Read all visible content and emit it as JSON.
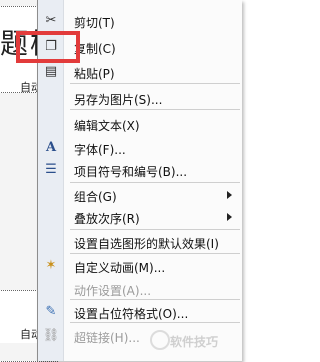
{
  "document": {
    "title_text": "题样",
    "subtitle_text": "自动",
    "subtitle_text_bottom": "自动"
  },
  "context_menu": {
    "items": [
      {
        "label": "剪切(T)",
        "icon": "scissors-icon"
      },
      {
        "label": "复制(C)",
        "icon": "copy-icon"
      },
      {
        "label": "粘贴(P)",
        "icon": "paste-icon"
      },
      {
        "label": "另存为图片(S)...",
        "icon": ""
      },
      {
        "label": "编辑文本(X)",
        "icon": ""
      },
      {
        "label": "字体(F)...",
        "icon": "font-icon"
      },
      {
        "label": "项目符号和编号(B)...",
        "icon": "bullets-icon"
      },
      {
        "label": "组合(G)",
        "icon": ""
      },
      {
        "label": "叠放次序(R)",
        "icon": ""
      },
      {
        "label": "设置自选图形的默认效果(I)",
        "icon": ""
      },
      {
        "label": "自定义动画(M)...",
        "icon": "animation-icon"
      },
      {
        "label": "动作设置(A)...",
        "icon": ""
      },
      {
        "label": "设置占位符格式(O)...",
        "icon": "format-icon"
      },
      {
        "label": "超链接(H)...",
        "icon": "hyperlink-icon"
      }
    ]
  },
  "watermark": {
    "text": "软件技巧"
  }
}
